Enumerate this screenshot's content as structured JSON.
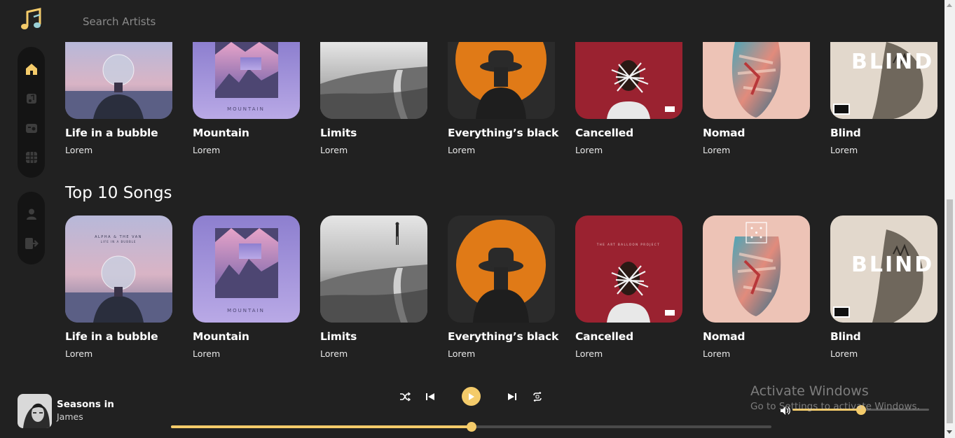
{
  "header": {
    "logo_icon": "music-note-icon",
    "search_placeholder": "Search Artists"
  },
  "sidebar": {
    "top": [
      {
        "name": "home",
        "icon": "home-icon",
        "active": true
      },
      {
        "name": "music",
        "icon": "music-file-icon",
        "active": false
      },
      {
        "name": "radio",
        "icon": "radio-icon",
        "active": false
      },
      {
        "name": "grid",
        "icon": "grid-icon",
        "active": false
      }
    ],
    "bottom": [
      {
        "name": "profile",
        "icon": "user-icon"
      },
      {
        "name": "logout",
        "icon": "logout-icon"
      }
    ]
  },
  "rows": [
    {
      "title": "",
      "items": [
        {
          "title": "Life in a bubble",
          "subtitle": "Lorem"
        },
        {
          "title": "Mountain",
          "subtitle": "Lorem"
        },
        {
          "title": "Limits",
          "subtitle": "Lorem"
        },
        {
          "title": "Everything’s black",
          "subtitle": "Lorem"
        },
        {
          "title": "Cancelled",
          "subtitle": "Lorem"
        },
        {
          "title": "Nomad",
          "subtitle": "Lorem"
        },
        {
          "title": "Blind",
          "subtitle": "Lorem"
        }
      ]
    },
    {
      "title": "Top 10 Songs",
      "items": [
        {
          "title": "Life in a bubble",
          "subtitle": "Lorem"
        },
        {
          "title": "Mountain",
          "subtitle": "Lorem"
        },
        {
          "title": "Limits",
          "subtitle": "Lorem"
        },
        {
          "title": "Everything’s black",
          "subtitle": "Lorem"
        },
        {
          "title": "Cancelled",
          "subtitle": "Lorem"
        },
        {
          "title": "Nomad",
          "subtitle": "Lorem"
        },
        {
          "title": "Blind",
          "subtitle": "Lorem"
        }
      ]
    }
  ],
  "covers": {
    "bubble_text_1": "ALPHA & THE VAN",
    "bubble_text_2": "LIFE IN A BUBBLE",
    "mountain_text": "MOUNTAIN",
    "cancelled_text": "THE ART BALLOON PROJECT",
    "blind_text": "BLIND"
  },
  "player": {
    "track_title": "Seasons in",
    "track_artist": "James",
    "progress_fraction": 0.5,
    "volume_fraction": 0.5
  },
  "watermark": {
    "title": "Activate Windows",
    "subtitle": "Go to Settings to activate Windows."
  },
  "colors": {
    "background": "#212121",
    "sidebar": "#141414",
    "accent": "#f4cb6a"
  }
}
